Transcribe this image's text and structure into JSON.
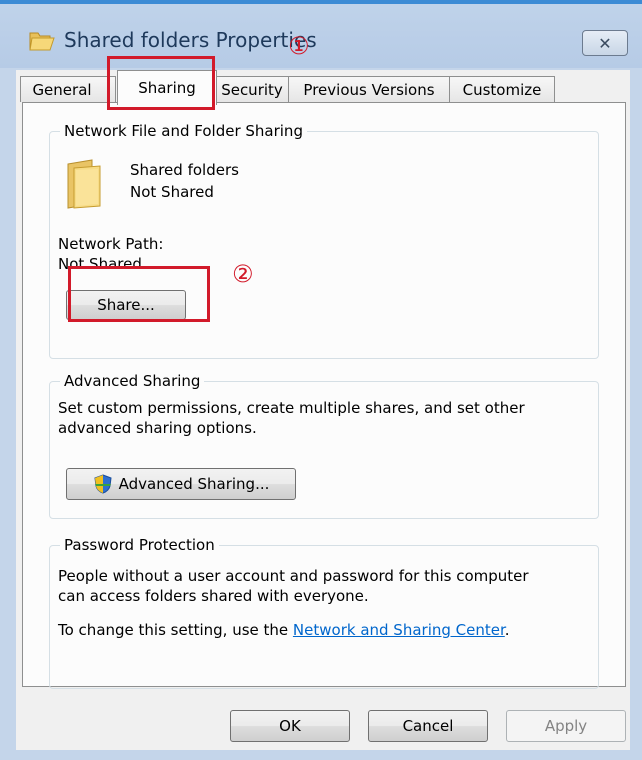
{
  "window": {
    "title": "Shared folders Properties"
  },
  "tabs": [
    {
      "label": "General"
    },
    {
      "label": "Sharing"
    },
    {
      "label": "Security"
    },
    {
      "label": "Previous Versions"
    },
    {
      "label": "Customize"
    }
  ],
  "network_sharing": {
    "group_label": "Network File and Folder Sharing",
    "folder_name": "Shared folders",
    "folder_status": "Not Shared",
    "path_label": "Network Path:",
    "path_value": "Not Shared",
    "share_button": "Share..."
  },
  "advanced_sharing": {
    "group_label": "Advanced Sharing",
    "description_line1": "Set custom permissions, create multiple shares, and set other",
    "description_line2": "advanced sharing options.",
    "button_label": "Advanced Sharing..."
  },
  "password_protection": {
    "group_label": "Password Protection",
    "line1": "People without a user account and password for this computer",
    "line2": "can access folders shared with everyone.",
    "change_prefix": "To change this setting, use the ",
    "link_text": "Network and Sharing Center",
    "change_suffix": "."
  },
  "footer": {
    "ok": "OK",
    "cancel": "Cancel",
    "apply": "Apply"
  },
  "annotations": {
    "marker1": "①",
    "marker2": "②"
  },
  "colors": {
    "annotation": "#d21a2a",
    "link": "#0066cc",
    "accent": "#3c8bd5"
  }
}
